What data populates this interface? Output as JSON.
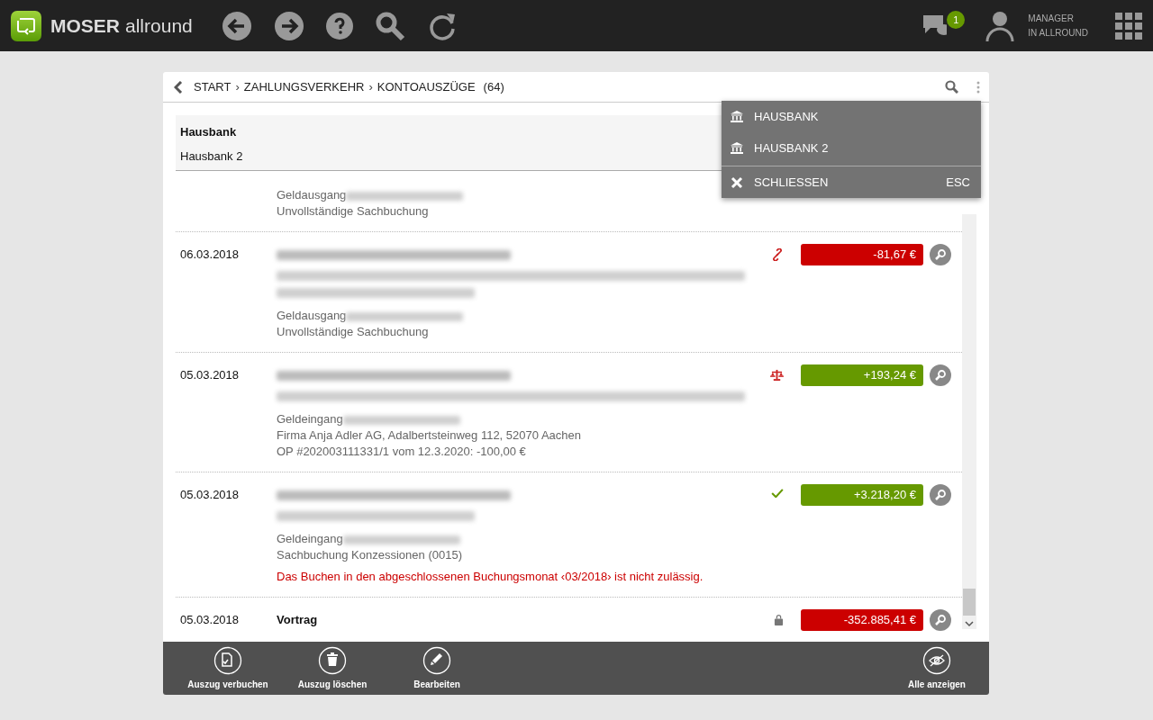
{
  "app": {
    "brand_bold": "MOSER",
    "brand_light": "allround",
    "messages_badge": "1",
    "user_line1": "MANAGER",
    "user_line2": "IN ALLROUND"
  },
  "breadcrumb": {
    "items": [
      "START",
      "ZAHLUNGSVERKEHR",
      "KONTOAUSZÜGE"
    ],
    "separator": "›",
    "count": "(64)"
  },
  "group": {
    "title": "Hausbank",
    "subtitle": "Hausbank 2"
  },
  "entries": [
    {
      "lines": [
        {
          "kind": "account",
          "text": "Geldausgang"
        },
        {
          "kind": "note",
          "text": "Unvollständige Sachbuchung"
        }
      ]
    },
    {
      "date": "06.03.2018",
      "kind": "link",
      "amount": "-81,67 €",
      "color": "#cc0000",
      "lines": [
        {
          "kind": "hidden-title"
        },
        {
          "kind": "hidden-memo"
        },
        {
          "kind": "hidden-memo-short"
        },
        {
          "kind": "account",
          "text": "Geldausgang"
        },
        {
          "kind": "note",
          "text": "Unvollständige Sachbuchung"
        }
      ]
    },
    {
      "date": "05.03.2018",
      "kind": "scale",
      "amount": "+193,24 €",
      "color": "#669900",
      "lines": [
        {
          "kind": "hidden-title"
        },
        {
          "kind": "hidden-memo"
        },
        {
          "kind": "account",
          "text": "Geldeingang"
        },
        {
          "kind": "note",
          "text": "Firma Anja Adler AG, Adalbertsteinweg 112, 52070 Aachen"
        },
        {
          "kind": "note",
          "text": "OP #202003111331/1 vom 12.3.2020: -100,00 €"
        }
      ]
    },
    {
      "date": "05.03.2018",
      "kind": "check",
      "amount": "+3.218,20 €",
      "color": "#669900",
      "lines": [
        {
          "kind": "hidden-title"
        },
        {
          "kind": "hidden-memo-short"
        },
        {
          "kind": "account",
          "text": "Geldeingang"
        },
        {
          "kind": "note",
          "text": "Sachbuchung Konzessionen (0015)"
        },
        {
          "kind": "error",
          "text": "Das Buchen in den abgeschlossenen Buchungsmonat ‹03/2018› ist nicht zulässig."
        }
      ]
    },
    {
      "date": "05.03.2018",
      "kind": "lock",
      "amount": "-352.885,41 €",
      "color": "#cc0000",
      "lines": [
        {
          "kind": "title",
          "text": "Vortrag"
        }
      ]
    }
  ],
  "menu": {
    "items": [
      {
        "kind": "bank",
        "label": "HAUSBANK"
      },
      {
        "kind": "bank",
        "label": "HAUSBANK 2"
      },
      {
        "kind": "close",
        "label": "SCHLIESSEN",
        "shortcut": "ESC"
      }
    ]
  },
  "footer": [
    {
      "kind": "book",
      "label": "Auszug verbuchen"
    },
    {
      "kind": "trash",
      "label": "Auszug löschen"
    },
    {
      "kind": "pencil",
      "label": "Bearbeiten"
    },
    {
      "kind": "eye-off",
      "label": "Alle anzeigen"
    }
  ]
}
